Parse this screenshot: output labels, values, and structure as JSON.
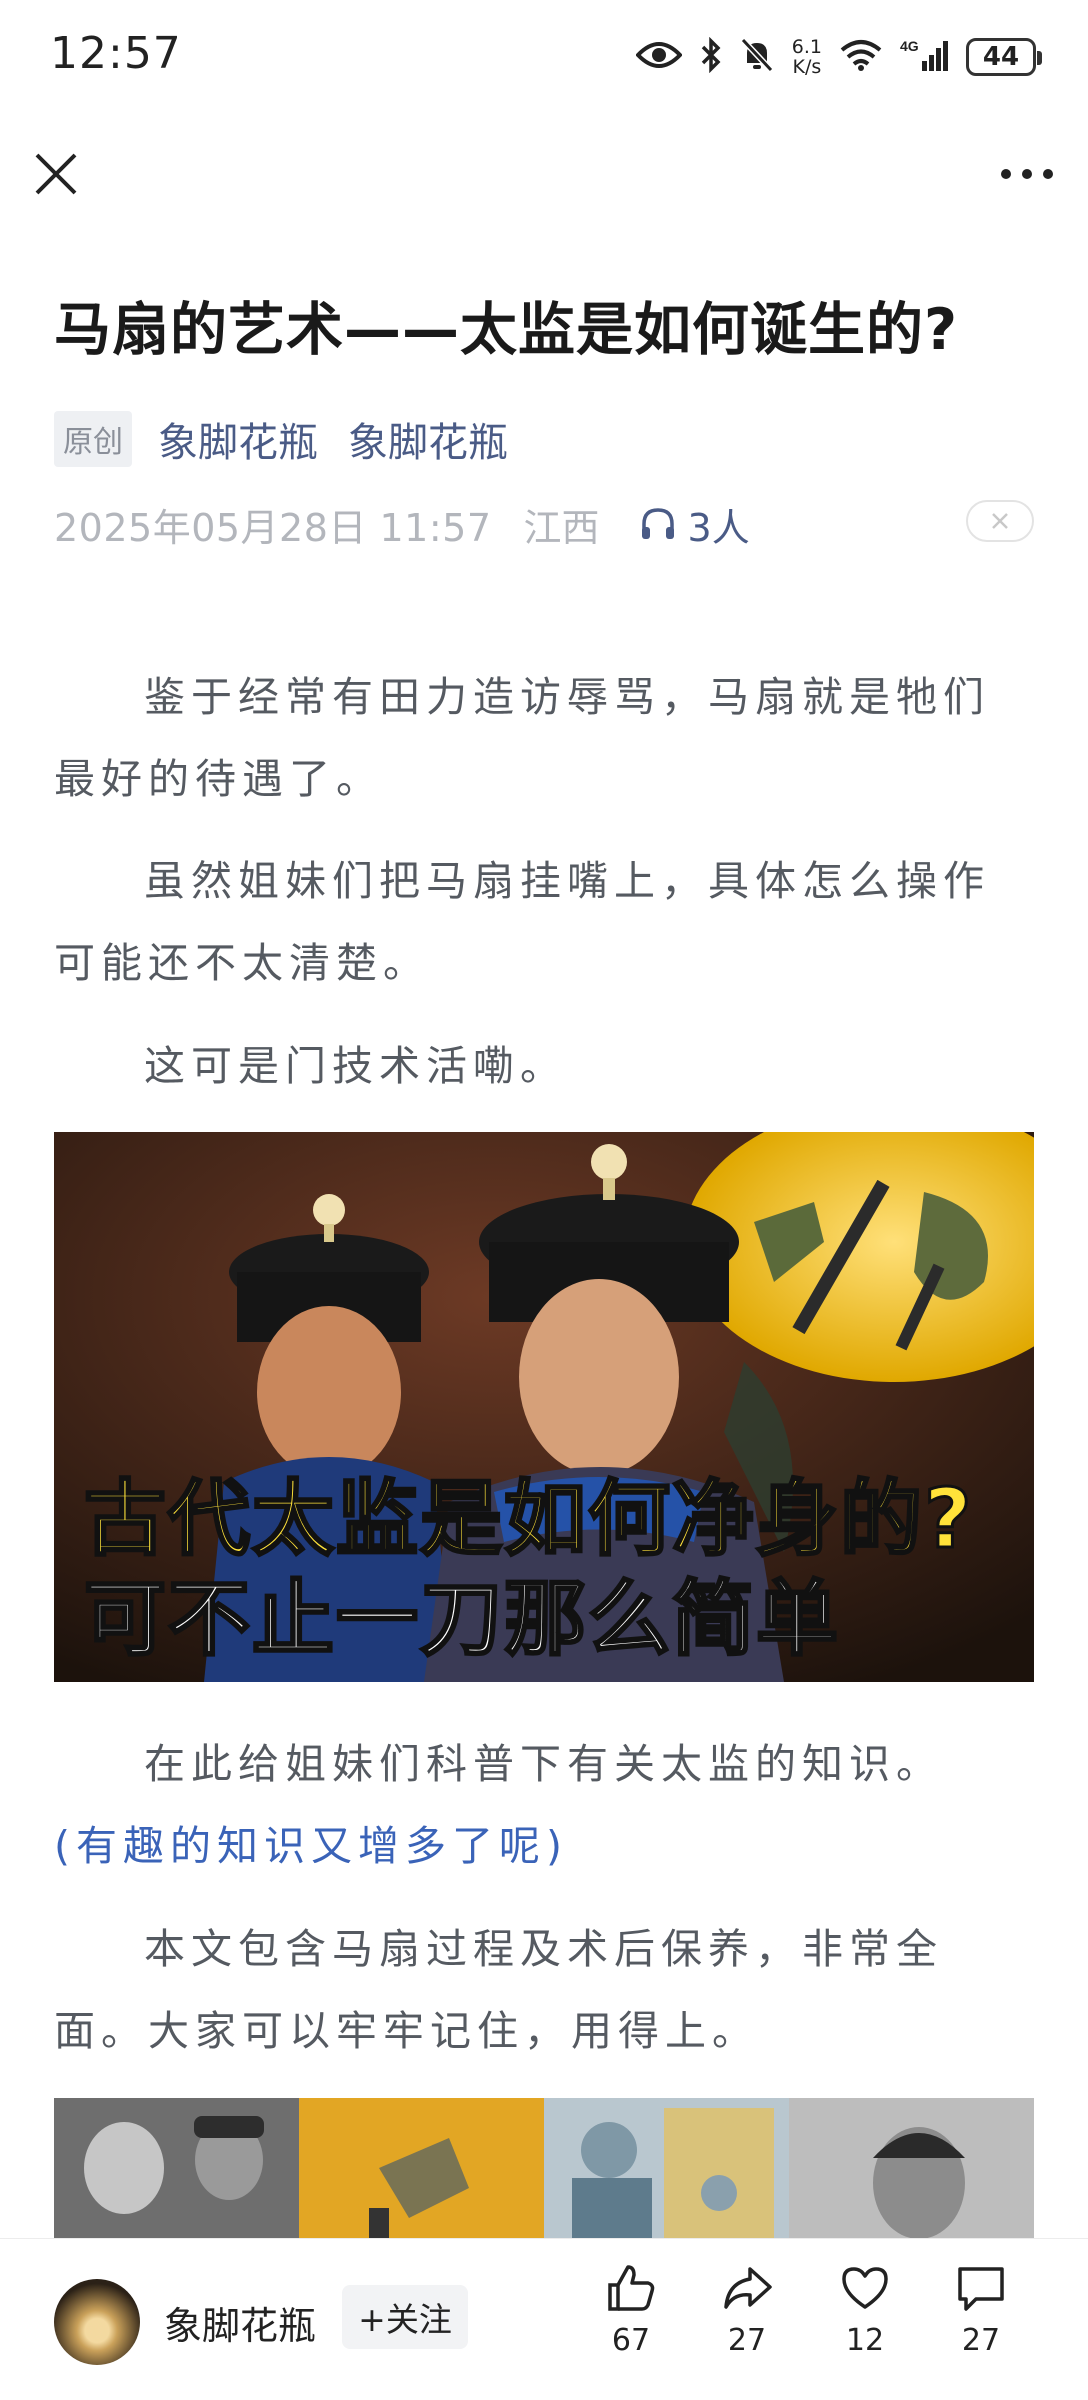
{
  "status_bar": {
    "time": "12:57",
    "net_speed_top": "6.1",
    "net_speed_bottom": "K/s",
    "signal_type": "4G",
    "battery": "44"
  },
  "article": {
    "title": "马扇的艺术——太监是如何诞生的?",
    "original_badge": "原创",
    "author_primary": "象脚花瓶",
    "author_secondary": "象脚花瓶",
    "date": "2025年05月28日 11:57",
    "location": "江西",
    "listeners": "3人",
    "paragraphs": [
      "鉴于经常有田力造访辱骂，马扇就是牠们最好的待遇了。",
      "虽然姐妹们把马扇挂嘴上，具体怎么操作可能还不太清楚。",
      "这可是门技术活嘞。"
    ],
    "hero_caption_1": "古代太监是如何净身的?",
    "hero_caption_2": "可不止一刀那么简单",
    "paragraph_after_image": "在此给姐妹们科普下有关太监的知识。",
    "link_line": "(有趣的知识又增多了呢)",
    "paragraph_last": "本文包含马扇过程及术后保养，非常全面。大家可以牢牢记住，用得上。"
  },
  "bottom_bar": {
    "author_name": "象脚花瓶",
    "follow_label": "+关注",
    "like_count": "67",
    "share_count": "27",
    "favorite_count": "12",
    "comment_count": "27"
  },
  "colors": {
    "link_blue": "#4a5b86",
    "accent_blue": "#3a63b8",
    "muted_gray": "#b3b6bc",
    "body_text": "#555a61"
  }
}
